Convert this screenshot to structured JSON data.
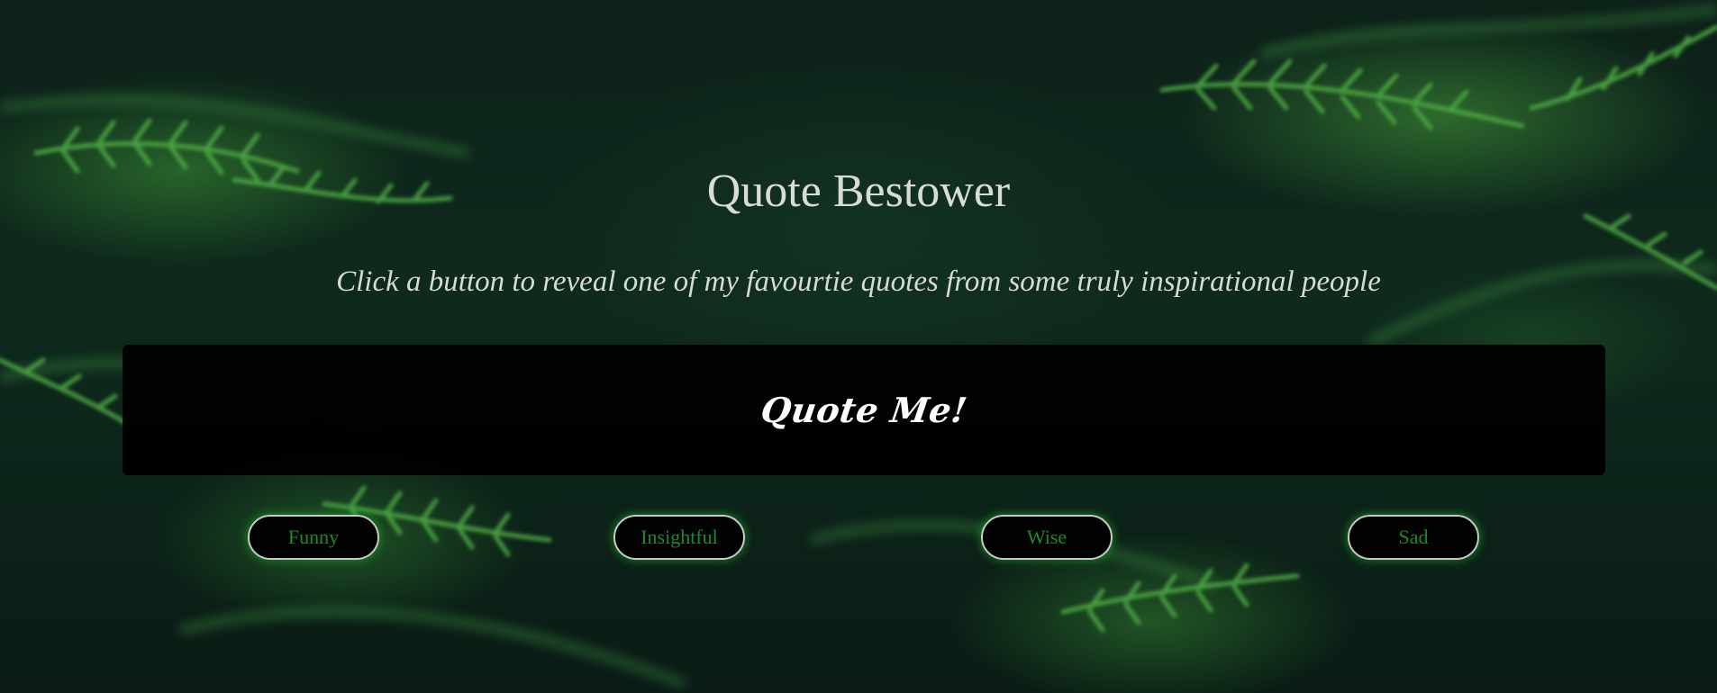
{
  "page": {
    "title": "Quote Bestower",
    "subtitle": "Click a button to reveal one of my favourtie quotes from some truly inspirational people"
  },
  "quote_panel": {
    "text": "Quote Me!"
  },
  "buttons": [
    {
      "label": "Funny"
    },
    {
      "label": "Insightful"
    },
    {
      "label": "Wise"
    },
    {
      "label": "Sad"
    }
  ],
  "colors": {
    "button_text": "#1f8a2a",
    "button_glow": "#1eaa28",
    "panel_background": "#000000",
    "heading_text": "#d9dcd6"
  }
}
